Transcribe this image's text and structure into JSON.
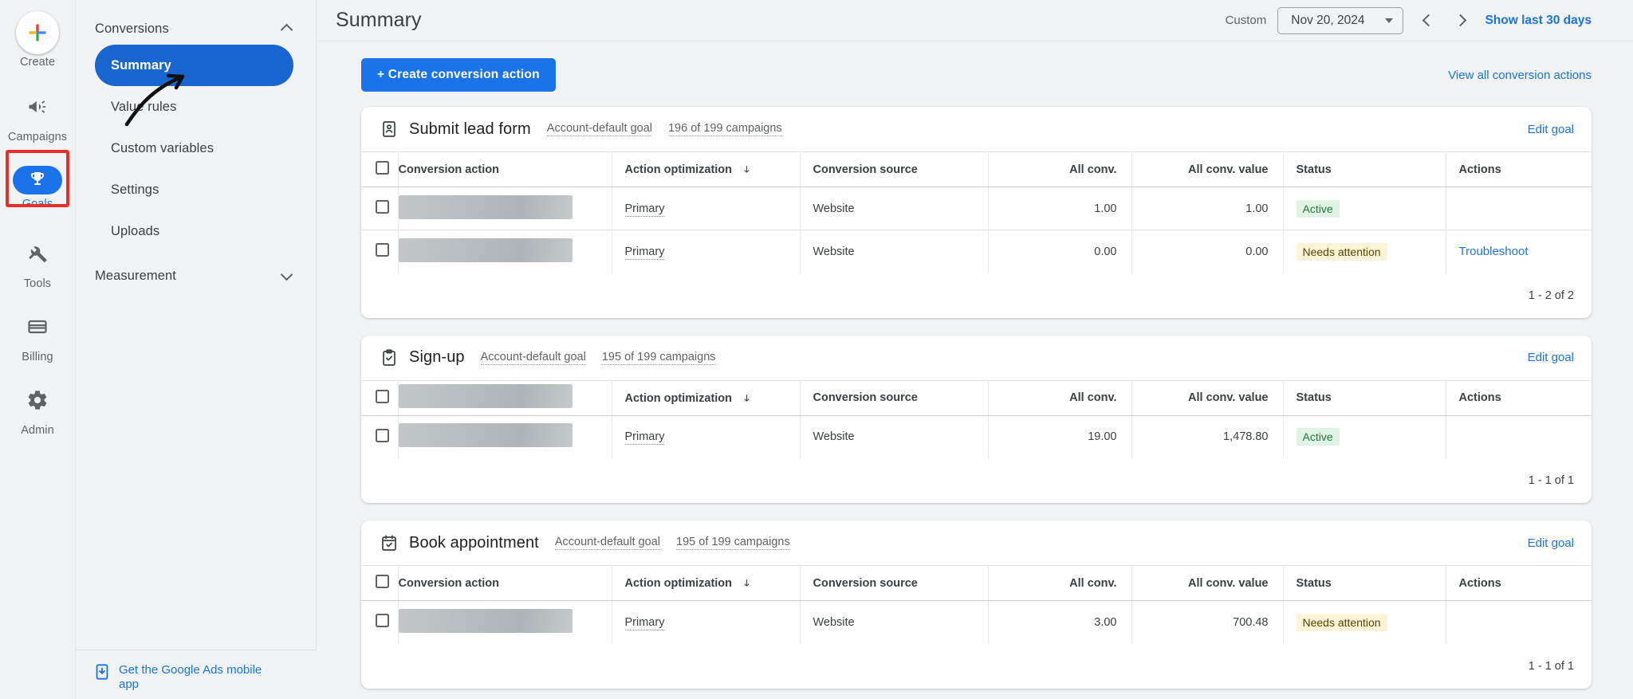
{
  "rail": {
    "items": [
      {
        "label": "Create",
        "icon": "plus-icon",
        "active": false
      },
      {
        "label": "Campaigns",
        "icon": "megaphone-icon",
        "active": false
      },
      {
        "label": "Goals",
        "icon": "trophy-icon",
        "active": true
      },
      {
        "label": "Tools",
        "icon": "tools-icon",
        "active": false
      },
      {
        "label": "Billing",
        "icon": "credit-card-icon",
        "active": false
      },
      {
        "label": "Admin",
        "icon": "gear-icon",
        "active": false
      }
    ]
  },
  "nav": {
    "groups": [
      {
        "label": "Conversions",
        "expanded": true,
        "items": [
          {
            "label": "Summary",
            "selected": true
          },
          {
            "label": "Value rules",
            "selected": false
          },
          {
            "label": "Custom variables",
            "selected": false
          },
          {
            "label": "Settings",
            "selected": false
          },
          {
            "label": "Uploads",
            "selected": false
          }
        ]
      },
      {
        "label": "Measurement",
        "expanded": false,
        "items": []
      }
    ],
    "mobile_promo": "Get the Google Ads mobile app"
  },
  "header": {
    "title": "Summary",
    "date_label": "Custom",
    "date_value": "Nov 20, 2024",
    "prev_icon": "chevron-left-icon",
    "next_icon": "chevron-right-icon",
    "show_last": "Show last 30 days"
  },
  "actions": {
    "create_label": "+ Create conversion action",
    "view_all_label": "View all conversion actions"
  },
  "columns": {
    "conversion_action": "Conversion action",
    "action_optimization": "Action optimization",
    "conversion_source": "Conversion source",
    "all_conv": "All conv.",
    "all_conv_value": "All conv. value",
    "status": "Status",
    "actions": "Actions"
  },
  "goal_meta_labels": {
    "edit": "Edit goal",
    "account_default": "Account-default goal"
  },
  "cards": [
    {
      "icon": "contact-card-icon",
      "name": "Submit lead form",
      "account_default": "Account-default goal",
      "campaigns": "196 of 199 campaigns",
      "edit_label": "Edit goal",
      "header_name_redacted": false,
      "rows": [
        {
          "name_redacted": true,
          "optimization": "Primary",
          "source": "Website",
          "all_conv": "1.00",
          "all_conv_value": "1.00",
          "status": "Active",
          "status_kind": "active",
          "action": ""
        },
        {
          "name_redacted": true,
          "optimization": "Primary",
          "source": "Website",
          "all_conv": "0.00",
          "all_conv_value": "0.00",
          "status": "Needs attention",
          "status_kind": "warn",
          "action": "Troubleshoot"
        }
      ],
      "pagination": "1 - 2 of 2"
    },
    {
      "icon": "clipboard-check-icon",
      "name": "Sign-up",
      "account_default": "Account-default goal",
      "campaigns": "195 of 199 campaigns",
      "edit_label": "Edit goal",
      "header_name_redacted": true,
      "rows": [
        {
          "name_redacted": true,
          "optimization": "Primary",
          "source": "Website",
          "all_conv": "19.00",
          "all_conv_value": "1,478.80",
          "status": "Active",
          "status_kind": "active",
          "action": ""
        }
      ],
      "pagination": "1 - 1 of 1"
    },
    {
      "icon": "calendar-check-icon",
      "name": "Book appointment",
      "account_default": "Account-default goal",
      "campaigns": "195 of 199 campaigns",
      "edit_label": "Edit goal",
      "header_name_redacted": false,
      "rows": [
        {
          "name_redacted": true,
          "optimization": "Primary",
          "source": "Website",
          "all_conv": "3.00",
          "all_conv_value": "700.48",
          "status": "Needs attention",
          "status_kind": "warn",
          "action": ""
        }
      ],
      "pagination": "1 - 1 of 1"
    }
  ],
  "colors": {
    "accent": "#1a73e8",
    "selected_nav": "#1a66d0",
    "annotation": "#e8302a",
    "status_active_bg": "#e0f3e4",
    "status_active_fg": "#1e7a3a",
    "status_warn_bg": "#fdf3d7",
    "status_warn_fg": "#574500",
    "page_bg": "#f1f3f4"
  }
}
